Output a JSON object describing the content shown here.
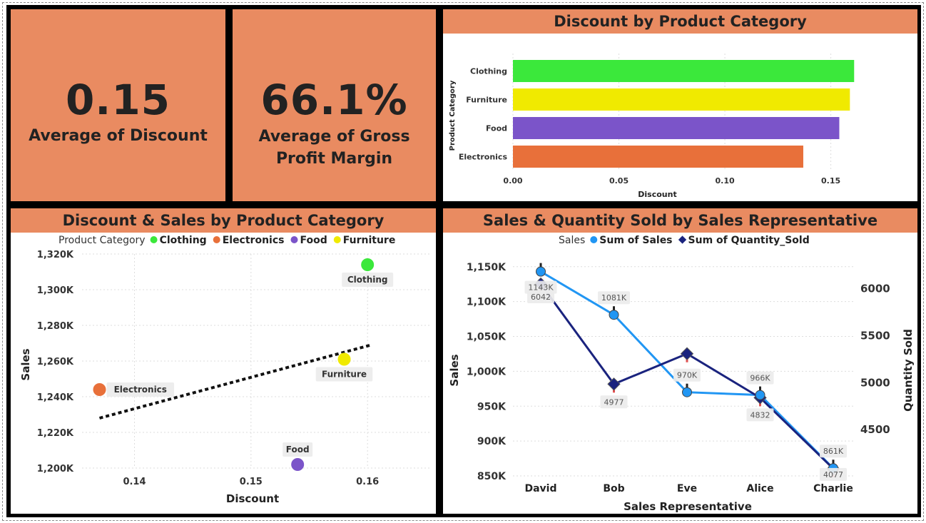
{
  "kpis": [
    {
      "value": "0.15",
      "label_lines": [
        "Average of Discount"
      ]
    },
    {
      "value": "66.1%",
      "label_lines": [
        "Average of Gross",
        "Profit Margin"
      ]
    }
  ],
  "colors": {
    "header": "#E98B61",
    "clothing": "#3BE83B",
    "furniture": "#F0EA00",
    "food": "#7B54C9",
    "electronics": "#E8703A",
    "sales_line": "#2196F3",
    "quantity_line": "#1A237E",
    "trend": "#111111"
  },
  "charts": {
    "bar": {
      "title": "Discount by Product Category",
      "type": "bar",
      "orientation": "horizontal",
      "xlabel": "Discount",
      "ylabel": "Product Category",
      "categories": [
        "Clothing",
        "Furniture",
        "Food",
        "Electronics"
      ],
      "values": [
        0.161,
        0.159,
        0.154,
        0.137
      ],
      "xlim": [
        0,
        0.17
      ],
      "xticks": [
        0.0,
        0.05,
        0.1,
        0.15
      ],
      "xtick_labels": [
        "0.00",
        "0.05",
        "0.10",
        "0.15"
      ],
      "bar_color_keys": [
        "clothing",
        "furniture",
        "food",
        "electronics"
      ],
      "grid": true
    },
    "scatter": {
      "title": "Discount & Sales by Product Category",
      "type": "scatter",
      "legend_title": "Product Category",
      "legend_position": "top",
      "xlabel": "Discount",
      "ylabel": "Sales",
      "xlim": [
        0.1355,
        0.1655
      ],
      "ylim": [
        1200,
        1320
      ],
      "xticks": [
        0.14,
        0.15,
        0.16
      ],
      "xtick_labels": [
        "0.14",
        "0.15",
        "0.16"
      ],
      "yticks": [
        1200,
        1220,
        1240,
        1260,
        1280,
        1300,
        1320
      ],
      "ytick_labels": [
        "1,200K",
        "1,220K",
        "1,240K",
        "1,260K",
        "1,280K",
        "1,300K",
        "1,320K"
      ],
      "points": [
        {
          "name": "Clothing",
          "x": 0.16,
          "y": 1314,
          "color_key": "clothing",
          "label_pos": "below"
        },
        {
          "name": "Electronics",
          "x": 0.137,
          "y": 1244,
          "color_key": "electronics",
          "label_pos": "right"
        },
        {
          "name": "Food",
          "x": 0.154,
          "y": 1202,
          "color_key": "food",
          "label_pos": "above"
        },
        {
          "name": "Furniture",
          "x": 0.158,
          "y": 1261,
          "color_key": "furniture",
          "label_pos": "below"
        }
      ],
      "trendline": {
        "x": [
          0.137,
          0.1603
        ],
        "y": [
          1228,
          1269
        ]
      },
      "grid": true
    },
    "combo": {
      "title": "Sales & Quantity Sold by Sales Representative",
      "type": "line",
      "legend_title": "Sales",
      "legend_position": "top",
      "xlabel": "Sales Representative",
      "ylabel": "Sales",
      "y2label": "Quantity Sold",
      "categories": [
        "David",
        "Bob",
        "Eve",
        "Alice",
        "Charlie"
      ],
      "ylim": [
        850,
        1160
      ],
      "yticks": [
        850,
        900,
        950,
        1000,
        1050,
        1100,
        1150
      ],
      "ytick_labels": [
        "850K",
        "900K",
        "950K",
        "1,000K",
        "1,050K",
        "1,100K",
        "1,150K"
      ],
      "y2lim": [
        4000,
        6300
      ],
      "y2ticks": [
        4500,
        5000,
        5500,
        6000
      ],
      "y2tick_labels": [
        "4500",
        "5000",
        "5500",
        "6000"
      ],
      "series": [
        {
          "name": "Sum of Sales",
          "axis": "left",
          "color_key": "sales_line",
          "marker": "circle",
          "values": [
            1143,
            1081,
            970,
            966,
            861
          ],
          "labels": [
            "1143K",
            "1081K",
            "970K",
            "966K",
            "861K"
          ]
        },
        {
          "name": "Sum of Quantity_Sold",
          "axis": "right",
          "color_key": "quantity_line",
          "marker": "diamond",
          "values": [
            6042,
            4977,
            5300,
            4832,
            4077
          ],
          "labels": [
            "6042",
            "4977",
            "",
            "4832",
            "4077"
          ]
        }
      ],
      "grid": true
    }
  }
}
